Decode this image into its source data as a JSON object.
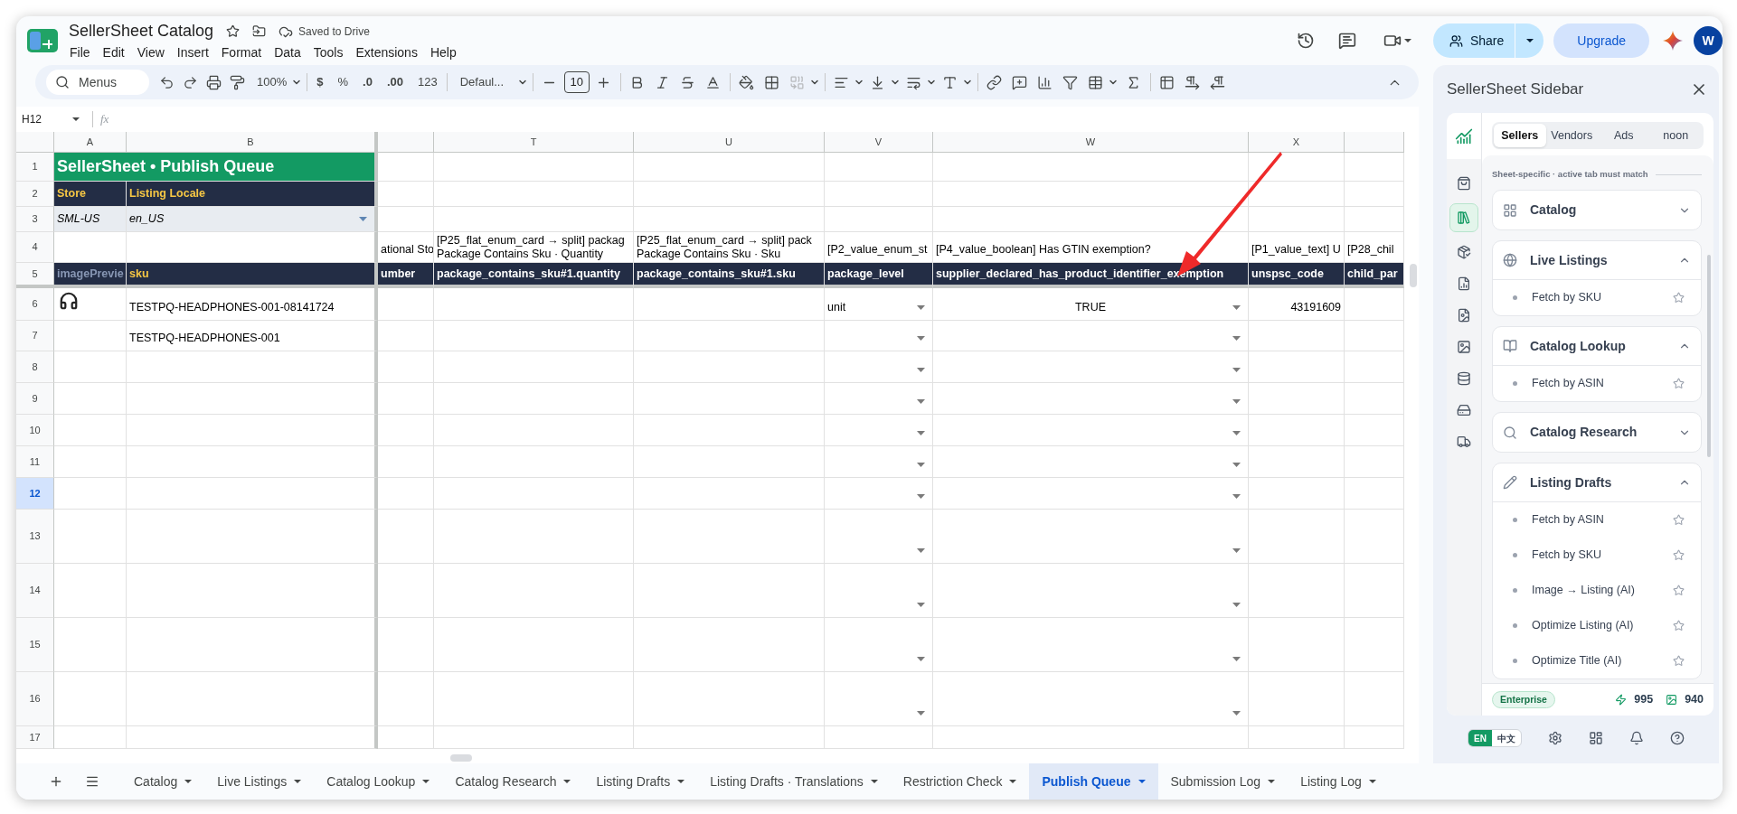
{
  "document": {
    "title": "SellerSheet Catalog",
    "save_status": "Saved to Drive",
    "menus": [
      "File",
      "Edit",
      "View",
      "Insert",
      "Format",
      "Data",
      "Tools",
      "Extensions",
      "Help"
    ]
  },
  "header_actions": {
    "share": "Share",
    "upgrade": "Upgrade",
    "avatar": "W"
  },
  "toolbar": {
    "search_placeholder": "Menus",
    "zoom": "100%",
    "currency": "$",
    "percent": "%",
    "decrease_decimals": ".0",
    "increase_decimals": ".00",
    "number_format": "123",
    "font": "Defaul...",
    "font_size": "10"
  },
  "formula_bar": {
    "cell": "H12",
    "fx": "fx"
  },
  "grid": {
    "columns": [
      "A",
      "B",
      null,
      "T",
      "U",
      "V",
      "W",
      "X",
      null
    ],
    "rows": [
      {
        "number": "1",
        "selected": false,
        "cells": [
          {
            "text": "SellerSheet • Publish Queue",
            "kind": "title"
          },
          null,
          null,
          null,
          null,
          null,
          null,
          null,
          null
        ]
      },
      {
        "number": "2",
        "selected": false,
        "cells": [
          {
            "text": "Store",
            "kind": "label"
          },
          {
            "text": "Listing Locale",
            "kind": "label"
          },
          null,
          null,
          null,
          null,
          null,
          null,
          null
        ]
      },
      {
        "number": "3",
        "selected": false,
        "cells": [
          {
            "text": "SML-US",
            "kind": "input"
          },
          {
            "text": "en_US",
            "kind": "input",
            "dropdown": true
          },
          null,
          null,
          null,
          null,
          null,
          null,
          null
        ]
      },
      {
        "number": "4",
        "selected": false,
        "cells": [
          null,
          null,
          {
            "text": "ational Sto"
          },
          {
            "text": "[P25_flat_enum_card → split] packag\nPackage Contains Sku · Quantity"
          },
          {
            "text": "[P25_flat_enum_card → split] pack\nPackage Contains Sku · Sku"
          },
          {
            "text": "[P2_value_enum_st"
          },
          {
            "text": "[P4_value_boolean] Has GTIN exemption?"
          },
          {
            "text": "[P1_value_text] U"
          },
          {
            "text": "[P28_chil"
          }
        ]
      },
      {
        "number": "5",
        "selected": false,
        "cells": [
          {
            "text": "imagePrevie",
            "kind": "header-muted"
          },
          {
            "text": "sku",
            "kind": "header-accent"
          },
          {
            "text": "umber",
            "kind": "header"
          },
          {
            "text": "package_contains_sku#1.quantity",
            "kind": "header"
          },
          {
            "text": "package_contains_sku#1.sku",
            "kind": "header"
          },
          {
            "text": "package_level",
            "kind": "header"
          },
          {
            "text": "supplier_declared_has_product_identifier_exemption",
            "kind": "header"
          },
          {
            "text": "unspsc_code",
            "kind": "header"
          },
          {
            "text": "child_par",
            "kind": "header"
          }
        ]
      },
      {
        "number": "6",
        "selected": false,
        "cells": [
          {
            "kind": "image"
          },
          {
            "text": "TESTPQ-HEADPHONES-001-08141724"
          },
          null,
          null,
          null,
          {
            "text": "unit",
            "dropdown": true
          },
          {
            "text": "TRUE",
            "kind": "boolean",
            "dropdown": true
          },
          {
            "text": "43191609",
            "kind": "number"
          },
          null
        ]
      },
      {
        "number": "7",
        "selected": false,
        "cells": [
          null,
          {
            "text": "TESTPQ-HEADPHONES-001"
          },
          null,
          null,
          null,
          {
            "dropdown": true
          },
          {
            "dropdown": true
          },
          null,
          null
        ]
      },
      {
        "number": "8",
        "selected": false,
        "cells": [
          null,
          null,
          null,
          null,
          null,
          {
            "dropdown": true
          },
          {
            "dropdown": true
          },
          null,
          null
        ]
      },
      {
        "number": "9",
        "selected": false,
        "cells": [
          null,
          null,
          null,
          null,
          null,
          {
            "dropdown": true
          },
          {
            "dropdown": true
          },
          null,
          null
        ]
      },
      {
        "number": "10",
        "selected": false,
        "cells": [
          null,
          null,
          null,
          null,
          null,
          {
            "dropdown": true
          },
          {
            "dropdown": true
          },
          null,
          null
        ]
      },
      {
        "number": "11",
        "selected": false,
        "cells": [
          null,
          null,
          null,
          null,
          null,
          {
            "dropdown": true
          },
          {
            "dropdown": true
          },
          null,
          null
        ]
      },
      {
        "number": "12",
        "selected": true,
        "cells": [
          null,
          null,
          null,
          null,
          null,
          {
            "dropdown": true
          },
          {
            "dropdown": true
          },
          null,
          null
        ]
      },
      {
        "number": "13",
        "selected": false,
        "cells": [
          null,
          null,
          null,
          null,
          null,
          {
            "dropdown": true
          },
          {
            "dropdown": true
          },
          null,
          null
        ]
      },
      {
        "number": "14",
        "selected": false,
        "cells": [
          null,
          null,
          null,
          null,
          null,
          {
            "dropdown": true
          },
          {
            "dropdown": true
          },
          null,
          null
        ]
      },
      {
        "number": "15",
        "selected": false,
        "cells": [
          null,
          null,
          null,
          null,
          null,
          {
            "dropdown": true
          },
          {
            "dropdown": true
          },
          null,
          null
        ]
      },
      {
        "number": "16",
        "selected": false,
        "cells": [
          null,
          null,
          null,
          null,
          null,
          {
            "dropdown": true
          },
          {
            "dropdown": true
          },
          null,
          null
        ]
      },
      {
        "number": "17",
        "selected": false,
        "cells": [
          null,
          null,
          null,
          null,
          null,
          null,
          null,
          null,
          null
        ]
      }
    ]
  },
  "sidebar": {
    "title": "SellerSheet Sidebar",
    "rail_items": [
      {
        "selected": false
      },
      {
        "selected": true
      },
      {
        "selected": false
      },
      {
        "selected": false
      },
      {
        "selected": false
      },
      {
        "selected": false
      },
      {
        "selected": false
      },
      {
        "selected": false
      },
      {
        "selected": false
      }
    ],
    "tabs": [
      {
        "label": "Sellers",
        "selected": true
      },
      {
        "label": "Vendors",
        "selected": false
      },
      {
        "label": "Ads",
        "selected": false
      },
      {
        "label": "noon",
        "selected": false
      }
    ],
    "section_label": "Sheet-specific · active tab must match",
    "groups": [
      {
        "title": "Catalog",
        "expanded": false
      },
      {
        "title": "Live Listings",
        "expanded": true,
        "items": [
          "Fetch by SKU"
        ]
      },
      {
        "title": "Catalog Lookup",
        "expanded": true,
        "items": [
          "Fetch by ASIN"
        ]
      },
      {
        "title": "Catalog Research",
        "expanded": false
      },
      {
        "title": "Listing Drafts",
        "expanded": true,
        "items": [
          "Fetch by ASIN",
          "Fetch by SKU",
          "Image → Listing (AI)",
          "Optimize Listing (AI)",
          "Optimize Title (AI)"
        ]
      }
    ],
    "plan": "Enterprise",
    "credits": "995",
    "image_credits": "940",
    "languages": [
      {
        "label": "EN",
        "selected": true
      },
      {
        "label": "中文",
        "selected": false
      }
    ]
  },
  "sheet_tabs": [
    {
      "label": "Catalog",
      "selected": false
    },
    {
      "label": "Live Listings",
      "selected": false
    },
    {
      "label": "Catalog Lookup",
      "selected": false
    },
    {
      "label": "Catalog Research",
      "selected": false
    },
    {
      "label": "Listing Drafts",
      "selected": false
    },
    {
      "label": "Listing Drafts · Translations",
      "selected": false
    },
    {
      "label": "Restriction Check",
      "selected": false
    },
    {
      "label": "Publish Queue",
      "selected": true
    },
    {
      "label": "Submission Log",
      "selected": false
    },
    {
      "label": "Listing Log",
      "selected": false
    }
  ]
}
